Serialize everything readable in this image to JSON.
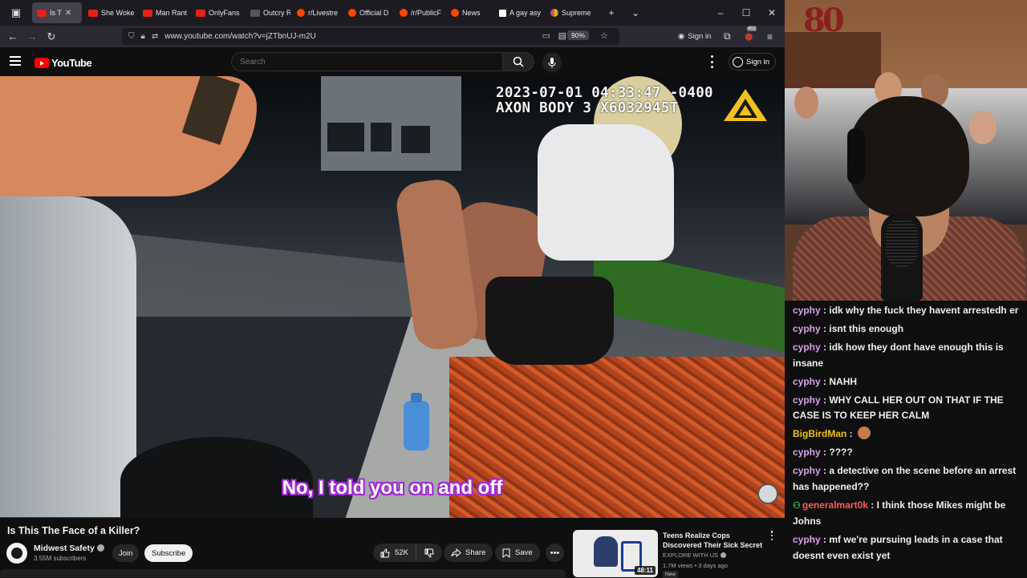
{
  "browser": {
    "tabs": [
      {
        "label": "Is T",
        "active": true,
        "favicon": "youtube"
      },
      {
        "label": "She Woke",
        "favicon": "youtube"
      },
      {
        "label": "Man Rant",
        "favicon": "youtube"
      },
      {
        "label": "OnlyFans",
        "favicon": "youtube"
      },
      {
        "label": "Outcry Re",
        "favicon": "yf"
      },
      {
        "label": "r/Livestre",
        "favicon": "reddit"
      },
      {
        "label": "Official D",
        "favicon": "reddit"
      },
      {
        "label": "/r/PublicF",
        "favicon": "reddit"
      },
      {
        "label": "News",
        "favicon": "reddit"
      },
      {
        "label": "A gay asy",
        "favicon": "ap"
      },
      {
        "label": "Supreme",
        "favicon": "multi"
      }
    ],
    "url": "www.youtube.com/watch?v=jZTbnUJ-m2U",
    "zoom": "90%",
    "signin_label": "Sign in",
    "extension_badge": "402"
  },
  "youtube": {
    "logo_text": "YouTube",
    "search_placeholder": "Search",
    "signin_label": "Sign in"
  },
  "video": {
    "hud_line1": "2023-07-01 04:33:47 -0400",
    "hud_line2": "AXON BODY 3 X6032945T",
    "caption": "No, I told you on and off",
    "title": "Is This The Face of a Killer?"
  },
  "channel": {
    "name": "Midwest Safety",
    "subscribers": "3.55M subscribers",
    "join_label": "Join",
    "subscribe_label": "Subscribe"
  },
  "actions": {
    "likes": "52K",
    "share_label": "Share",
    "save_label": "Save"
  },
  "recommendation": {
    "title": "Teens Realize Cops Discovered Their Sick Secret",
    "channel": "EXPLORE WITH US",
    "meta": "1.7M views • 3 days ago",
    "duration": "48:11",
    "badge": "New"
  },
  "chat": [
    {
      "user": "cyphy",
      "text": "idk why the fuck they havent arrestedh er"
    },
    {
      "user": "cyphy",
      "text": "isnt this enough"
    },
    {
      "user": "cyphy",
      "text": "idk how they dont have enough this is insane"
    },
    {
      "user": "cyphy",
      "text": "NAHH"
    },
    {
      "user": "cyphy",
      "text": "WHY CALL HER OUT ON THAT IF THE CASE IS TO KEEP HER CALM"
    },
    {
      "user": "BigBirdMan",
      "text": "",
      "emote": true,
      "style": "bird"
    },
    {
      "user": "cyphy",
      "text": "????"
    },
    {
      "user": "cyphy",
      "text": "a detective on the scene before an arrest has happened??"
    },
    {
      "user": "generalmart0k",
      "text": "I think those Mikes might be Johns",
      "style": "green",
      "badge": true
    },
    {
      "user": "cyphy",
      "text": "mf we're pursuing leads in a case that doesnt even exist yet"
    }
  ]
}
